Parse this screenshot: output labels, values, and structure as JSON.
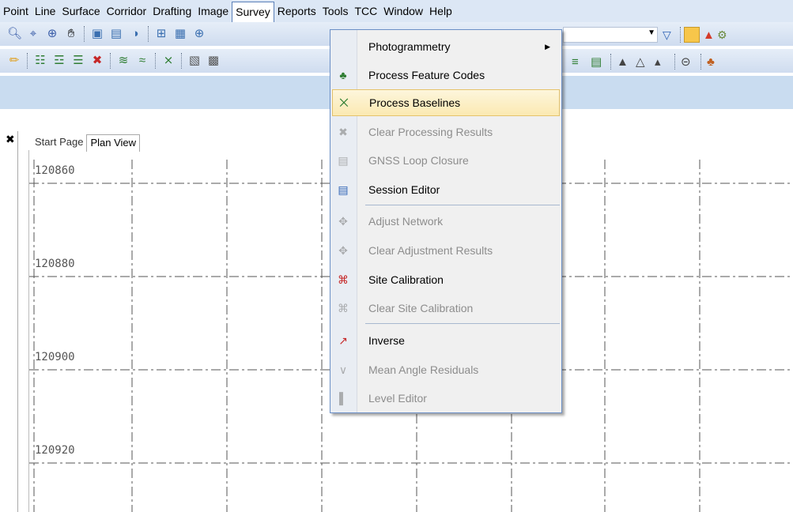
{
  "menubar": {
    "items": [
      "Point",
      "Line",
      "Surface",
      "Corridor",
      "Drafting",
      "Image",
      "Survey",
      "Reports",
      "Tools",
      "TCC",
      "Window",
      "Help"
    ]
  },
  "tabs": [
    {
      "label": "Start Page"
    },
    {
      "label": "Plan View"
    }
  ],
  "y_labels": [
    "120860",
    "120880",
    "120900",
    "120920"
  ],
  "survey_menu": {
    "items": [
      {
        "label": "Photogrammetry",
        "icon": "none",
        "submenu": true,
        "enabled": true
      },
      {
        "label": "Process Feature Codes",
        "icon": "tree-icon",
        "enabled": true
      },
      {
        "label": "Process Baselines",
        "icon": "baseline-icon",
        "enabled": true,
        "highlighted": true
      },
      {
        "label": "Clear Processing Results",
        "icon": "clear-baseline-icon",
        "enabled": false
      },
      {
        "label": "GNSS Loop Closure",
        "icon": "loop-closure-icon",
        "enabled": false
      },
      {
        "label": "Session Editor",
        "icon": "session-editor-icon",
        "enabled": true
      },
      {
        "label": "Adjust Network",
        "icon": "network-icon",
        "enabled": false
      },
      {
        "label": "Clear Adjustment Results",
        "icon": "clear-network-icon",
        "enabled": false
      },
      {
        "label": "Site Calibration",
        "icon": "calibration-icon",
        "enabled": true
      },
      {
        "label": "Clear Site Calibration",
        "icon": "clear-calibration-icon",
        "enabled": false
      },
      {
        "label": "Inverse",
        "icon": "inverse-icon",
        "enabled": true
      },
      {
        "label": "Mean Angle Residuals",
        "icon": "angle-icon",
        "enabled": false
      },
      {
        "label": "Level Editor",
        "icon": "level-editor-icon",
        "enabled": false
      }
    ]
  },
  "colors": {
    "menubar_bg": "#dce7f5",
    "toolbar_bg": "#cfdcef",
    "strip_bg": "#c9dcf0",
    "highlight_bg": "#fbe9b2",
    "highlight_border": "#e5c36b",
    "menu_border": "#6b8fc6"
  }
}
